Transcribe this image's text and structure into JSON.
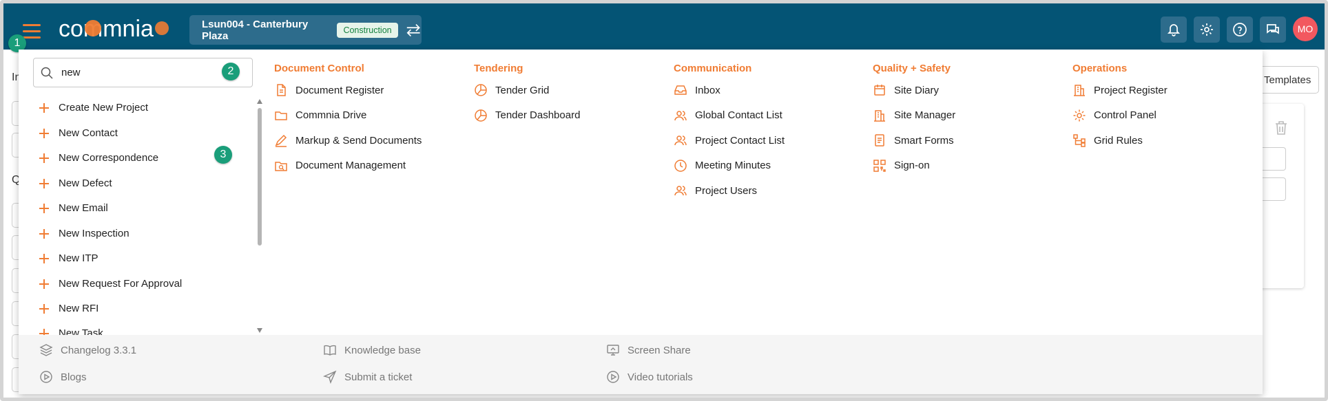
{
  "header": {
    "logo_text": "commnia",
    "project_label": "Lsun004 - Canterbury Plaza",
    "stage_badge": "Construction",
    "avatar_initials": "MO"
  },
  "annotations": [
    "1",
    "2",
    "3"
  ],
  "background": {
    "letters": [
      "In",
      "Q"
    ],
    "templates_button": "Templates"
  },
  "search": {
    "value": "new",
    "placeholder": ""
  },
  "quick_actions": [
    "Create New Project",
    "New Contact",
    "New Correspondence",
    "New Defect",
    "New Email",
    "New Inspection",
    "New ITP",
    "New Request For Approval",
    "New RFI",
    "New Task"
  ],
  "menu": [
    {
      "heading": "Document Control",
      "items": [
        {
          "label": "Document Register",
          "icon": "document-icon"
        },
        {
          "label": "Commnia Drive",
          "icon": "folder-icon"
        },
        {
          "label": "Markup & Send Documents",
          "icon": "pen-icon"
        },
        {
          "label": "Document Management",
          "icon": "folder-search-icon"
        }
      ]
    },
    {
      "heading": "Tendering",
      "items": [
        {
          "label": "Tender Grid",
          "icon": "pie-chart-icon"
        },
        {
          "label": "Tender Dashboard",
          "icon": "pie-chart-icon"
        }
      ]
    },
    {
      "heading": "Communication",
      "items": [
        {
          "label": "Inbox",
          "icon": "inbox-icon"
        },
        {
          "label": "Global Contact List",
          "icon": "users-icon"
        },
        {
          "label": "Project Contact List",
          "icon": "users-icon"
        },
        {
          "label": "Meeting Minutes",
          "icon": "clock-icon"
        },
        {
          "label": "Project Users",
          "icon": "users-icon"
        }
      ]
    },
    {
      "heading": "Quality + Safety",
      "items": [
        {
          "label": "Site Diary",
          "icon": "calendar-icon"
        },
        {
          "label": "Site Manager",
          "icon": "building-icon"
        },
        {
          "label": "Smart Forms",
          "icon": "form-icon"
        },
        {
          "label": "Sign-on",
          "icon": "qr-code-icon"
        }
      ]
    },
    {
      "heading": "Operations",
      "items": [
        {
          "label": "Project Register",
          "icon": "building-icon"
        },
        {
          "label": "Control Panel",
          "icon": "gear-icon"
        },
        {
          "label": "Grid Rules",
          "icon": "hierarchy-icon"
        }
      ]
    }
  ],
  "footer": [
    {
      "label": "Changelog 3.3.1",
      "icon": "layers-icon"
    },
    {
      "label": "Blogs",
      "icon": "play-circle-icon"
    },
    {
      "label": "Knowledge base",
      "icon": "book-icon"
    },
    {
      "label": "Submit a ticket",
      "icon": "send-icon"
    },
    {
      "label": "Screen Share",
      "icon": "screen-share-icon"
    },
    {
      "label": "Video tutorials",
      "icon": "play-circle-icon"
    }
  ],
  "colors": {
    "topbar": "#045475",
    "accent": "#f07c33",
    "annotation": "#1a9e7a",
    "stage_badge_bg": "#e6f4ea",
    "stage_badge_text": "#13803e",
    "avatar": "#f2585f"
  }
}
